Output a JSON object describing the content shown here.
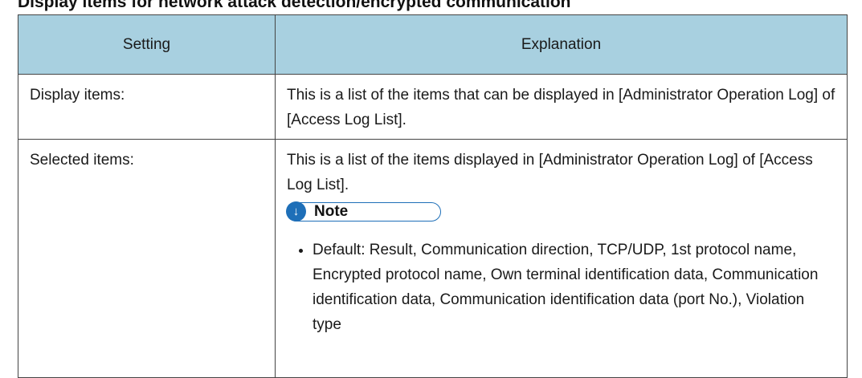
{
  "heading": "Display items for network attack detection/encrypted communication",
  "table": {
    "headers": [
      "Setting",
      "Explanation"
    ],
    "rows": [
      {
        "setting": "Display items:",
        "explanation": "This is a list of the items that can be displayed in [Administrator Operation Log] of [Access Log List]."
      },
      {
        "setting": "Selected items:",
        "explanation": "This is a list of the items displayed in [Administrator Operation Log] of [Access Log List].",
        "note": {
          "icon": "down-arrow-icon",
          "label": "Note",
          "items": [
            "Default: Result, Communication direction, TCP/UDP, 1st protocol name, Encrypted protocol name, Own terminal identification data, Communication identification data, Communication identification data (port No.), Violation type"
          ]
        }
      }
    ]
  },
  "colors": {
    "header_bg": "#a8d0e0",
    "note_accent": "#1e6fb8",
    "border": "#444444"
  }
}
